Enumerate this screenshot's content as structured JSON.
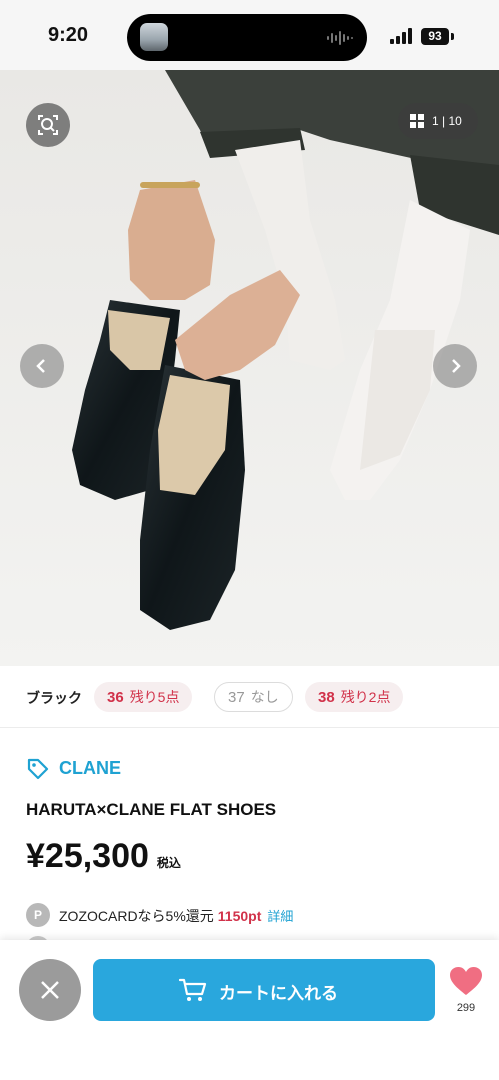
{
  "status_bar": {
    "time": "9:20",
    "battery": "93",
    "icons": [
      "signal-icon",
      "battery-icon",
      "audio-wave-icon"
    ]
  },
  "gallery": {
    "counter": "1 | 10",
    "icons": [
      "image-search-icon",
      "grid-icon",
      "chevron-left-icon",
      "chevron-right-icon"
    ]
  },
  "variations": {
    "color_name": "ブラック",
    "sizes": [
      {
        "size": "36",
        "stock": "残り5点",
        "available": true
      },
      {
        "size": "37",
        "stock": "なし",
        "available": false
      },
      {
        "size": "38",
        "stock": "残り2点",
        "available": true
      }
    ]
  },
  "product": {
    "brand": "CLANE",
    "name": "HARUTA×CLANE FLAT SHOES",
    "price": "¥25,300",
    "tax_label": "税込"
  },
  "points": {
    "badge": "P",
    "text": "ZOZOCARDなら5%還元",
    "value": "1150pt",
    "detail_link": "詳細"
  },
  "bottom_bar": {
    "cart_label": "カートに入れる",
    "favorite_count": "299"
  },
  "colors": {
    "brand_blue": "#1fa2d2",
    "cart_blue": "#29a7dd",
    "accent_red": "#d1324a",
    "heart_pink": "#f06e82"
  }
}
